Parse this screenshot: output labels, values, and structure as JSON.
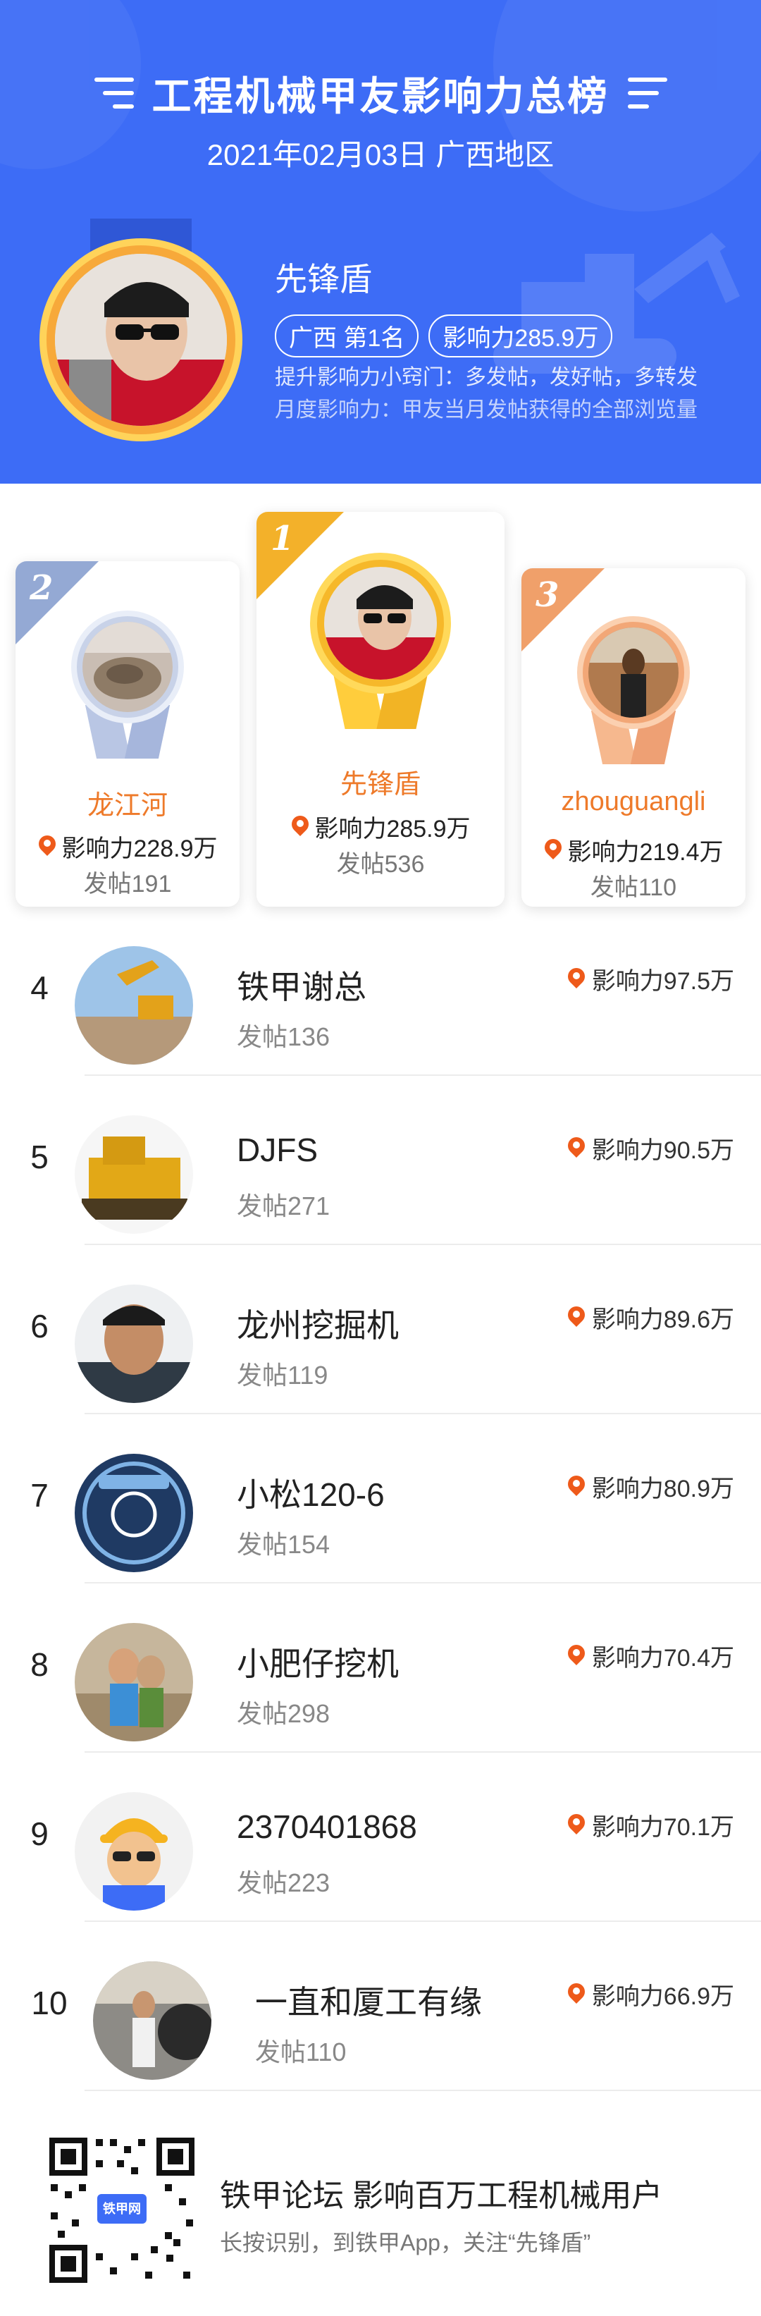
{
  "header": {
    "title": "工程机械甲友影响力总榜",
    "date_region": "2021年02月03日 广西地区",
    "me": {
      "name": "先锋盾",
      "region_rank": "广西  第1名",
      "influence": "影响力285.9万",
      "tip1": "提升影响力小窍门：多发帖，发好帖，多转发",
      "tip2": "月度影响力：甲友当月发帖获得的全部浏览量"
    }
  },
  "podium": [
    {
      "rank": "2",
      "name": "龙江河",
      "influence": "影响力228.9万",
      "posts": "发帖191",
      "color": "#94a9d4"
    },
    {
      "rank": "1",
      "name": "先锋盾",
      "influence": "影响力285.9万",
      "posts": "发帖536",
      "color": "#f3b12a"
    },
    {
      "rank": "3",
      "name": "zhouguangli",
      "influence": "影响力219.4万",
      "posts": "发帖110",
      "color": "#f0a06a"
    }
  ],
  "list": [
    {
      "rank": "4",
      "name": "铁甲谢总",
      "posts": "发帖136",
      "influence": "影响力97.5万"
    },
    {
      "rank": "5",
      "name": "DJFS",
      "posts": "发帖271",
      "influence": "影响力90.5万"
    },
    {
      "rank": "6",
      "name": "龙州挖掘机",
      "posts": "发帖119",
      "influence": "影响力89.6万"
    },
    {
      "rank": "7",
      "name": "小松120-6",
      "posts": "发帖154",
      "influence": "影响力80.9万"
    },
    {
      "rank": "8",
      "name": "小肥仔挖机",
      "posts": "发帖298",
      "influence": "影响力70.4万"
    },
    {
      "rank": "9",
      "name": "2370401868",
      "posts": "发帖223",
      "influence": "影响力70.1万"
    },
    {
      "rank": "10",
      "name": "一直和厦工有缘",
      "posts": "发帖110",
      "influence": "影响力66.9万"
    }
  ],
  "footer": {
    "title": "铁甲论坛 影响百万工程机械用户",
    "hint": "长按识别，到铁甲App，关注“先锋盾”",
    "qr_logo": "铁甲网"
  },
  "colors": {
    "header_bg": "#3d6cf6",
    "orange": "#ee7a2a",
    "gold": "#f3b12a",
    "silver": "#94a9d4",
    "bronze": "#f0a06a"
  }
}
